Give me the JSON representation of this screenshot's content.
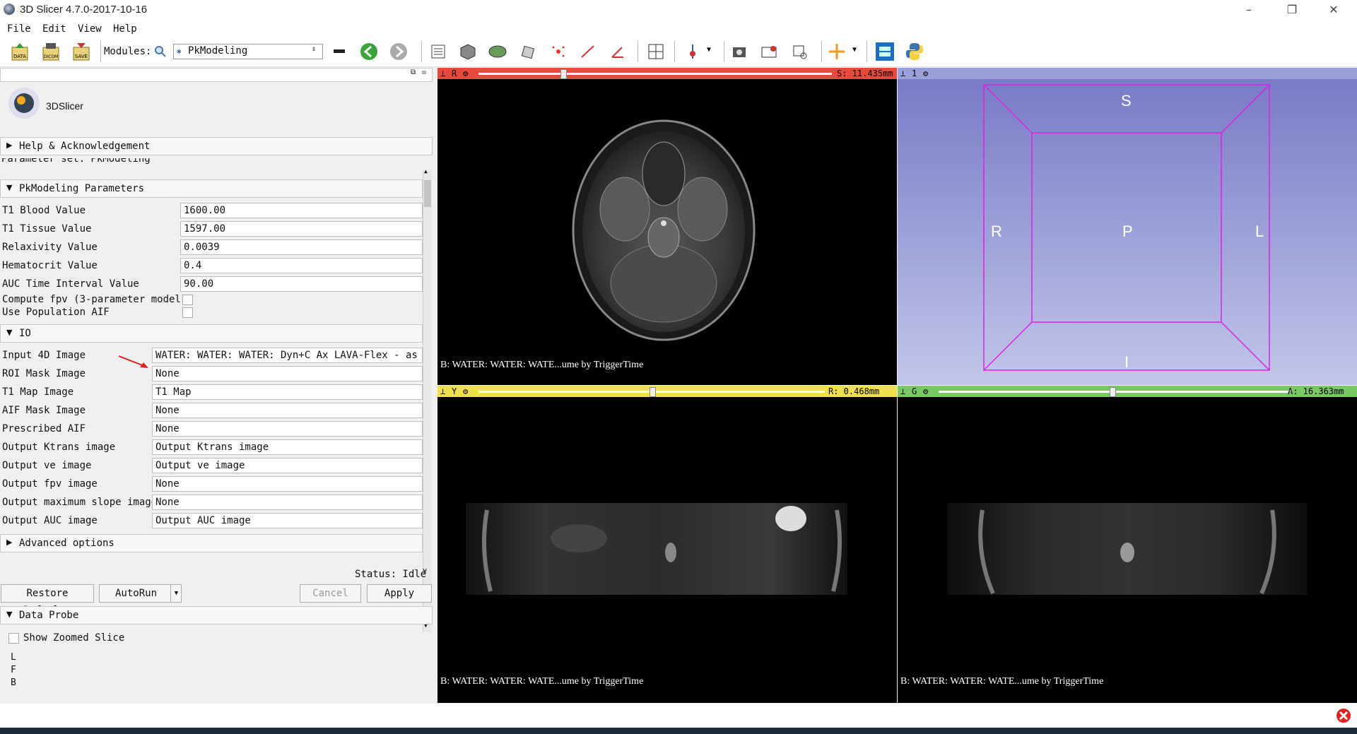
{
  "window": {
    "title": "3D Slicer 4.7.0-2017-10-16",
    "controls": [
      "–",
      "❐",
      "✕"
    ]
  },
  "menu": [
    "File",
    "Edit",
    "View",
    "Help"
  ],
  "toolbar": {
    "data_label": "DATA",
    "dicom_label": "DICOM",
    "save_label": "SAVE",
    "modules_label": "Modules:",
    "module_selected": "PkModeling"
  },
  "logo": {
    "text": "3DSlicer"
  },
  "sections": {
    "help": "Help & Acknowledgement",
    "parameter_set": "Parameter set: PkModeling",
    "pk_params": "PkModeling Parameters",
    "io": "IO",
    "advanced": "Advanced options",
    "data_probe": "Data Probe"
  },
  "params": [
    {
      "label": "T1 Blood Value",
      "value": "1600.00"
    },
    {
      "label": "T1 Tissue Value",
      "value": "1597.00"
    },
    {
      "label": "Relaxivity Value",
      "value": "0.0039"
    },
    {
      "label": "Hematocrit Value",
      "value": "0.4"
    },
    {
      "label": "AUC Time Interval Value",
      "value": "90.00"
    }
  ],
  "checks": [
    {
      "label": "Compute fpv (3-parameter model)",
      "checked": false
    },
    {
      "label": "Use Population AIF",
      "checked": false
    }
  ],
  "io": [
    {
      "label": "Input 4D Image",
      "value": "WATER: WATER: WATER: Dyn+C Ax LAVA-Flex - as a"
    },
    {
      "label": "ROI Mask Image",
      "value": "None"
    },
    {
      "label": "T1 Map Image",
      "value": "T1 Map"
    },
    {
      "label": "AIF Mask Image",
      "value": "None"
    },
    {
      "label": "Prescribed AIF",
      "value": "None"
    },
    {
      "label": "Output Ktrans image",
      "value": "Output Ktrans image"
    },
    {
      "label": "Output ve image",
      "value": "Output ve image"
    },
    {
      "label": "Output fpv image",
      "value": "None"
    },
    {
      "label": "Output maximum slope image",
      "value": "None"
    },
    {
      "label": "Output AUC image",
      "value": "Output AUC image"
    }
  ],
  "status": "Status: Idle",
  "buttons": {
    "restore": "Restore Defaults",
    "autorun": "AutoRun",
    "cancel": "Cancel",
    "apply": "Apply"
  },
  "probe": {
    "zoom_label": "Show Zoomed Slice",
    "letters": [
      "L",
      "F",
      "B"
    ]
  },
  "views": {
    "red": {
      "letter": "R",
      "offset": "S: 11.435mm",
      "color": "#e64a3c",
      "caption": "B: WATER: WATER: WATE...ume by TriggerTime"
    },
    "yellow": {
      "letter": "Y",
      "offset": "R: 0.468mm",
      "color": "#f0e050",
      "caption": "B: WATER: WATER: WATE...ume by TriggerTime"
    },
    "green": {
      "letter": "G",
      "offset": "A: 16.363mm",
      "color": "#78c864",
      "caption": "B: WATER: WATER: WATE...ume by TriggerTime"
    },
    "threed": {
      "label": "1",
      "axes": {
        "S": "S",
        "I": "I",
        "R": "R",
        "L": "L",
        "P": "P"
      }
    }
  }
}
